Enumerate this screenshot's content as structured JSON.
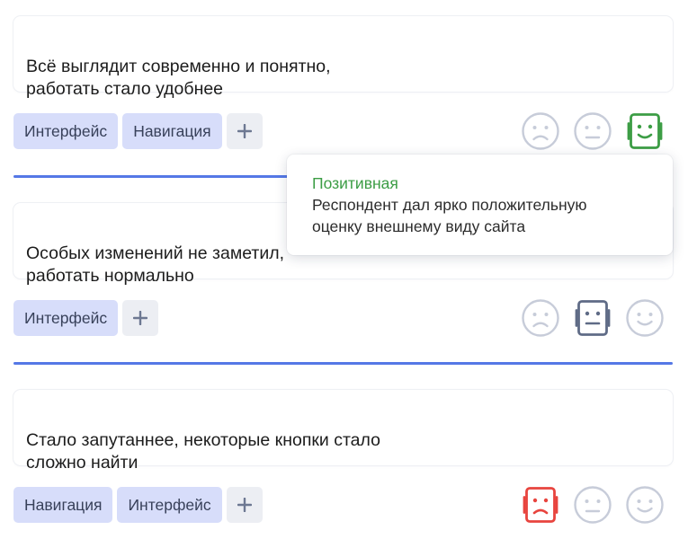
{
  "responses": [
    {
      "text": "Всё выглядит современно и понятно,\nработать стало удобнее",
      "tags": [
        "Интерфейс",
        "Навигация"
      ],
      "sentiment": "positive"
    },
    {
      "text": "Особых изменений не заметил,\nработать нормально",
      "tags": [
        "Интерфейс"
      ],
      "sentiment": "neutral"
    },
    {
      "text": "Стало запутаннее, некоторые кнопки стало\nсложно найти",
      "tags": [
        "Навигация",
        "Интерфейс"
      ],
      "sentiment": "negative"
    }
  ],
  "tooltip": {
    "title": "Позитивная",
    "description": "Респондент дал ярко положительную\nоценку внешнему виду сайта"
  },
  "colors": {
    "tag_bg": "#d7ddfa",
    "divider": "#5578e6",
    "positive": "#3c9d45",
    "neutral_selected": "#5f6b86",
    "negative": "#e8443e",
    "inactive": "#c7ccd9"
  },
  "icons": {
    "add": "plus-icon",
    "negative": "sad-face-icon",
    "neutral": "neutral-face-icon",
    "positive": "happy-face-icon"
  }
}
